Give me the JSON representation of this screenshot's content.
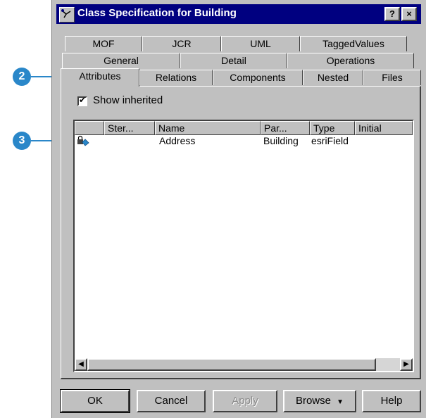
{
  "callouts": {
    "first": "2",
    "second": "3"
  },
  "window": {
    "title": "Class Specification for Building",
    "help_btn": "?",
    "close_btn": "×"
  },
  "tabs": {
    "row1": [
      "MOF",
      "JCR",
      "UML",
      "TaggedValues"
    ],
    "row2": [
      "General",
      "Detail",
      "Operations"
    ],
    "row3": [
      "Attributes",
      "Relations",
      "Components",
      "Nested",
      "Files"
    ],
    "active": "Attributes"
  },
  "show_inherited": {
    "label": "Show inherited",
    "checked": true,
    "check_mark": "✔"
  },
  "attributes_list": {
    "columns": [
      "Ster...",
      "Name",
      "Par...",
      "Type",
      "Initial"
    ],
    "rows": [
      {
        "icon": "attribute-lock-icon",
        "stereotype": "",
        "name": "Address",
        "parent": "Building",
        "type": "esriField",
        "initial": ""
      }
    ],
    "scroll_left": "◀",
    "scroll_right": "▶"
  },
  "buttons": {
    "ok": "OK",
    "cancel": "Cancel",
    "apply": "Apply",
    "browse": "Browse",
    "browse_arrow": "▼",
    "help": "Help"
  }
}
